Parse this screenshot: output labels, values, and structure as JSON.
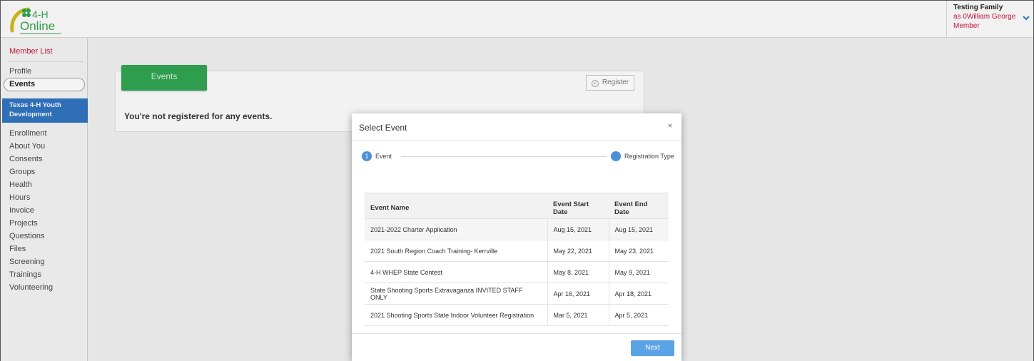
{
  "header": {
    "logo_text": "4-H Online",
    "user_name": "Testing Family",
    "user_as": "as 0William George",
    "user_role": "Member"
  },
  "sidebar": {
    "member_list": "Member List",
    "profile": "Profile",
    "events": "Events",
    "org_name": "Texas 4-H Youth Development",
    "items": [
      "Enrollment",
      "About You",
      "Consents",
      "Groups",
      "Health",
      "Hours",
      "Invoice",
      "Projects",
      "Questions",
      "Files",
      "Screening",
      "Trainings",
      "Volunteering"
    ]
  },
  "main": {
    "events_tab": "Events",
    "register_label": "Register",
    "empty_message": "You're not registered for any events."
  },
  "modal": {
    "title": "Select Event",
    "close_glyph": "×",
    "steps": [
      {
        "number": "1",
        "label": "Event"
      },
      {
        "number": "",
        "label": "Registration Type"
      }
    ],
    "columns": [
      "Event Name",
      "Event Start Date",
      "Event End Date"
    ],
    "rows": [
      [
        "2021-2022 Charter Application",
        "Aug 15, 2021",
        "Aug 15, 2021"
      ],
      [
        "2021 South Region Coach Training- Kerrville",
        "May 22, 2021",
        "May 23, 2021"
      ],
      [
        "4-H WHEP State Contest",
        "May 8, 2021",
        "May 9, 2021"
      ],
      [
        "State Shooting Sports Extravaganza INVITED STAFF ONLY",
        "Apr 16, 2021",
        "Apr 18, 2021"
      ],
      [
        "2021 Shooting Sports State Indoor Volunteer Registration",
        "Mar 5, 2021",
        "Apr 5, 2021"
      ]
    ],
    "next_label": "Next"
  },
  "colors": {
    "brand_green": "#2e9d4d",
    "accent_red": "#c0143c",
    "org_blue": "#2f6fb8",
    "step_blue": "#4a90d9",
    "next_blue": "#5aa3e6"
  }
}
